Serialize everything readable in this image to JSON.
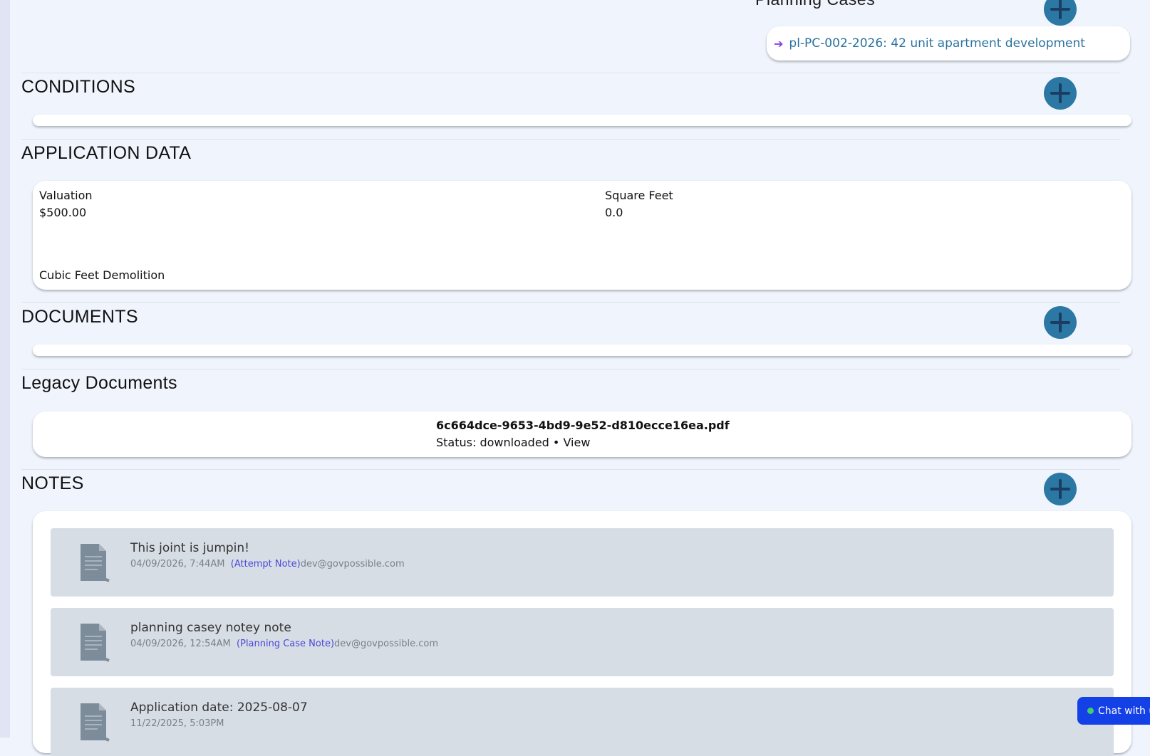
{
  "planning_cases": {
    "title": "Planning Cases",
    "link": "pl-PC-002-2026: 42 unit apartment development"
  },
  "conditions": {
    "title": "CONDITIONS"
  },
  "application_data": {
    "title": "APPLICATION DATA",
    "fields": [
      {
        "label": "Valuation",
        "value": "$500.00"
      },
      {
        "label": "Square Feet",
        "value": "0.0"
      },
      {
        "label": "Cubic Feet Demolition",
        "value": ""
      }
    ]
  },
  "documents": {
    "title": "DOCUMENTS"
  },
  "legacy_documents": {
    "title": "Legacy Documents",
    "file_name": "6c664dce-9653-4bd9-9e52-d810ecce16ea.pdf",
    "status_text": "Status: downloaded • ",
    "view_label": "View"
  },
  "notes": {
    "title": "NOTES",
    "items": [
      {
        "title": "This joint is jumpin!",
        "timestamp": "04/09/2026, 7:44AM",
        "type": "(Attempt Note)",
        "author": "dev@govpossible.com"
      },
      {
        "title": "planning casey notey note",
        "timestamp": "04/09/2026, 12:54AM",
        "type": "(Planning Case Note)",
        "author": "dev@govpossible.com"
      },
      {
        "title": "Application date: 2025-08-07",
        "timestamp": "11/22/2025, 5:03PM",
        "type": "",
        "author": ""
      }
    ]
  },
  "chat": {
    "label": "Chat with us"
  },
  "colors": {
    "accent": "#2a78a3",
    "link": "#2a73a0",
    "note_type": "#4a48d8",
    "chat": "#1440e8"
  }
}
